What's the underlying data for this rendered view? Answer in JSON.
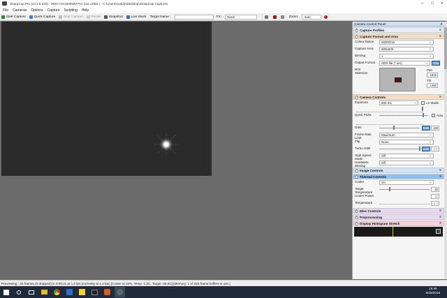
{
  "window": {
    "title": "SharpCap Pro (v3.1.5.220) - ZWO ASI1600MM Pro (via USB3.) - C:\\Users\\mahdy\\Desktop\\SharpCap Captures",
    "min": "—",
    "max": "☐",
    "close": "✕"
  },
  "menu": [
    "File",
    "Cameras",
    "Options",
    "Capture",
    "Scripting",
    "Help"
  ],
  "toolbar": {
    "start_capture": "Start Capture",
    "quick_capture": "Quick Capture",
    "stop_capture": "Stop Capture",
    "pause": "Pause",
    "snapshot": "Snapshot",
    "live_stack": "Live Stack",
    "target_name": "Target Name :",
    "fx_label": "FX:",
    "fx_value": "None",
    "zoom_label": "Zoom:",
    "zoom_value": "Auto"
  },
  "panel": {
    "title": "Camera Control Panel",
    "close": "✕",
    "sections": {
      "capture_profiles": "Capture Profiles",
      "capture_format": "Capture Format and Area",
      "camera_controls": "Camera Controls",
      "image_controls": "Image Controls",
      "thermal_controls": "Thermal Controls",
      "misc_controls": "Misc Controls",
      "preprocessing": "Preprocessing",
      "display_histogram": "Display Histogram Stretch"
    },
    "format": {
      "colour_space_label": "Colour Space",
      "colour_space": "MONO16",
      "capture_area_label": "Capture Area",
      "capture_area": "800x600",
      "binning_label": "Binning",
      "binning": "1",
      "output_format_label": "Output Format",
      "output_format": "SER file (*.ser)",
      "output_auto": "Auto",
      "roi_label": "ROI Selection",
      "pan_label": "Pan",
      "pan_value": "1920",
      "tilt_label": "Tilt",
      "tilt_value": "1460"
    },
    "camera": {
      "exposure_label": "Exposure",
      "exposure": "500 ms",
      "lx_mode": "LX Mode",
      "quick_picks_label": "Quick Picks",
      "quick_picks_auto": "Auto",
      "gain_label": "Gain",
      "gain_auto": "Auto",
      "gain_value": "139",
      "gain_level": 0.35,
      "frame_rate_label": "Frame Rate Limit",
      "frame_rate": "Maximum",
      "flip_label": "Flip",
      "flip": "None",
      "turbo_label": "Turbo USB",
      "turbo_auto": "Auto",
      "turbo_value": "100",
      "high_speed_label": "High Speed Mode",
      "high_speed": "Off",
      "hw_binning_label": "Hardware Binning",
      "hw_binning": "Off"
    },
    "thermal": {
      "cooler_label": "Cooler",
      "cooler": "On",
      "target_temp_label": "Target Temperature",
      "target_temp": "-25",
      "target_level": 0.2,
      "cooler_power_label": "Cooler Power",
      "cooler_power": "32",
      "temperature_label": "Temperature",
      "temperature": "-1.0"
    }
  },
  "status": "Previewing : 34 frames (0 dropped) in 0:00:21 at 1.6 fps  (currently at 1.3 fps) [Cooler at 32%, Temp -1.0C, Target -25.0C] [Memory: 1 of 325 frame buffers in use.]",
  "tray": {
    "time": "19:45",
    "date": "9/29/2019"
  },
  "colors": {
    "accent": "#5aa0e8",
    "section_orange": "#f6dcc0",
    "section_blue": "#cfe4fb",
    "section_purple": "#e8d8f4",
    "section_pink": "#f8d0d8"
  }
}
